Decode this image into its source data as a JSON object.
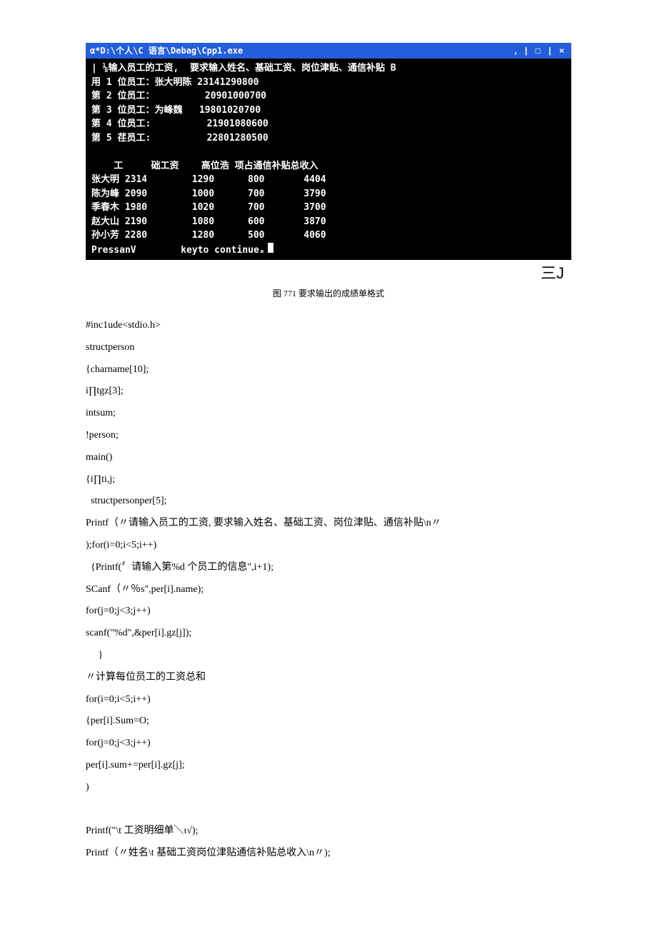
{
  "window": {
    "title": "α*D:\\个人\\C 语言\\Debag\\Cpp1.exe",
    "controls": ", | □ | ×"
  },
  "console_text": "| ⅛输入员工的工资,  要求输入姓名、基础工资、岗位津贴、通信补贴 B\n用 1 位员工：张大明陈 23141290800\n第 2 位员工：         20901000700\n第 3 位员工：为峰魏   19801020700\n第 4 位员工:          21901080600\n第 5 荏员工:          22801280500\n\n    工     础工资    高位浩 项占通信补贴总收入\n张大明 2314        1290      800       4404\n陈为峰 2090        1000      700       3790\n季春木 1980        1020      700       3700\n赵大山 2190        1080      600       3870\n孙小芳 2280        1280      500       4060\nPressanV        keyto continueₐ",
  "footer_glyph": "三J",
  "caption": "图 771 要求输出的成绩单格式",
  "code_lines": [
    "#inc1ude<stdio.h>",
    "structperson",
    "{charname[10];",
    "i∏tgz[3];",
    "intsum;",
    "!person;",
    "main()",
    "{i∏ti,j;",
    "  structpersonper[5];",
    "Printf（〃请输入员工的工资, 要求输入姓名、基础工资、岗位津贴、通信补贴\\n〃",
    ");for(i=0;i<5;i++)",
    "  {Printf(〞请输入第%d 个员工的信息\",i+1);",
    "SCanf（〃％s\",per[i].name);",
    "for(j=0;j<3;j++)",
    "scanf(\"%d\",&per[i].gz[j]);",
    "     }",
    "〃计算每位员工的工资总和",
    "for(i=0;i<5;i++)",
    "{per[i].Sum=O;",
    "for(j=0;j<3;j++)",
    "per[i].sum+=per[i].gz[j];",
    ")",
    "",
    "Printf(\"\\t 工资明细单＼ι√);",
    "Printf（〃姓名\\t 基础工资岗位津贴通信补贴总收入\\n〃);"
  ]
}
